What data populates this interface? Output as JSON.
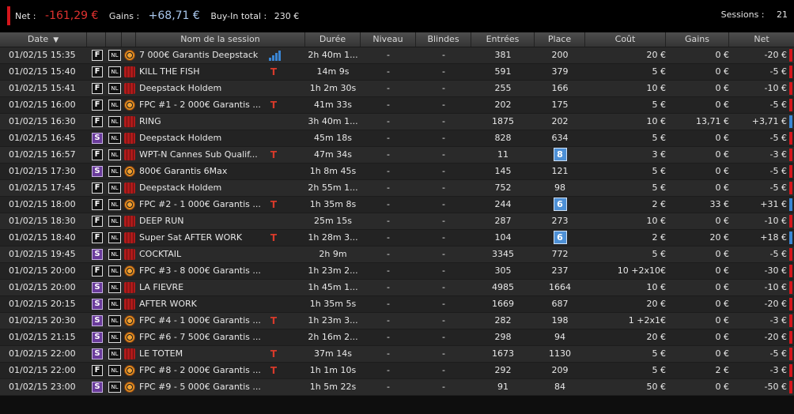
{
  "summary": {
    "net_label": "Net :",
    "net_value": "-161,29 €",
    "gains_label": "Gains :",
    "gains_value": "+68,71 €",
    "buyin_label": "Buy-In total :",
    "buyin_value": "230 €",
    "sessions_label": "Sessions :",
    "sessions_value": "21"
  },
  "colors": {
    "negative": "#d4161c",
    "positive": "#3a86d4",
    "badge": "#4d90d6"
  },
  "columns": {
    "date": "Date",
    "name": "Nom de la session",
    "duration": "Durée",
    "level": "Niveau",
    "blinds": "Blindes",
    "entries": "Entrées",
    "place": "Place",
    "cost": "Coût",
    "gains": "Gains",
    "net": "Net"
  },
  "rows": [
    {
      "date": "01/02/15 15:35",
      "game": "F",
      "nl": "NL",
      "room": "chip-icon",
      "name": "7 000€ Garantis Deepstack",
      "tag": "bars-icon",
      "duration": "2h 40m 1...",
      "level": "-",
      "blinds": "-",
      "entries": "381",
      "place": "200",
      "cost": "20 €",
      "gains": "0 €",
      "net": "-20 €",
      "result": "negative"
    },
    {
      "date": "01/02/15 15:40",
      "game": "F",
      "nl": "NL",
      "room": "deck-icon",
      "name": "KILL THE FISH",
      "tag": "ticket-icon",
      "duration": "14m 9s",
      "level": "-",
      "blinds": "-",
      "entries": "591",
      "place": "379",
      "cost": "5 €",
      "gains": "0 €",
      "net": "-5 €",
      "result": "negative"
    },
    {
      "date": "01/02/15 15:41",
      "game": "F",
      "nl": "NL",
      "room": "deck-icon",
      "name": "Deepstack Holdem",
      "tag": "",
      "duration": "1h 2m 30s",
      "level": "-",
      "blinds": "-",
      "entries": "255",
      "place": "166",
      "cost": "10 €",
      "gains": "0 €",
      "net": "-10 €",
      "result": "negative"
    },
    {
      "date": "01/02/15 16:00",
      "game": "F",
      "nl": "NL",
      "room": "chip-icon",
      "name": "FPC #1 - 2 000€ Garantis ...",
      "tag": "ticket-icon",
      "duration": "41m 33s",
      "level": "-",
      "blinds": "-",
      "entries": "202",
      "place": "175",
      "cost": "5 €",
      "gains": "0 €",
      "net": "-5 €",
      "result": "negative"
    },
    {
      "date": "01/02/15 16:30",
      "game": "F",
      "nl": "NL",
      "room": "deck-icon",
      "name": "RING",
      "tag": "",
      "duration": "3h 40m 1...",
      "level": "-",
      "blinds": "-",
      "entries": "1875",
      "place": "202",
      "cost": "10 €",
      "gains": "13,71 €",
      "net": "+3,71 €",
      "result": "positive"
    },
    {
      "date": "01/02/15 16:45",
      "game": "S",
      "nl": "NL",
      "room": "deck-icon",
      "name": "Deepstack Holdem",
      "tag": "",
      "duration": "45m 18s",
      "level": "-",
      "blinds": "-",
      "entries": "828",
      "place": "634",
      "cost": "5 €",
      "gains": "0 €",
      "net": "-5 €",
      "result": "negative"
    },
    {
      "date": "01/02/15 16:57",
      "game": "F",
      "nl": "NL",
      "room": "deck-icon",
      "name": "WPT-N Cannes Sub Qualif...",
      "tag": "ticket-icon",
      "duration": "47m 34s",
      "level": "-",
      "blinds": "-",
      "entries": "11",
      "place": "8",
      "place_badge": true,
      "cost": "3 €",
      "gains": "0 €",
      "net": "-3 €",
      "result": "negative"
    },
    {
      "date": "01/02/15 17:30",
      "game": "S",
      "nl": "NL",
      "room": "chip-icon",
      "name": "800€ Garantis 6Max",
      "tag": "",
      "duration": "1h 8m 45s",
      "level": "-",
      "blinds": "-",
      "entries": "145",
      "place": "121",
      "cost": "5 €",
      "gains": "0 €",
      "net": "-5 €",
      "result": "negative"
    },
    {
      "date": "01/02/15 17:45",
      "game": "F",
      "nl": "NL",
      "room": "deck-icon",
      "name": "Deepstack Holdem",
      "tag": "",
      "duration": "2h 55m 1...",
      "level": "-",
      "blinds": "-",
      "entries": "752",
      "place": "98",
      "cost": "5 €",
      "gains": "0 €",
      "net": "-5 €",
      "result": "negative"
    },
    {
      "date": "01/02/15 18:00",
      "game": "F",
      "nl": "NL",
      "room": "chip-icon",
      "name": "FPC #2 - 1 000€ Garantis ...",
      "tag": "ticket-icon",
      "duration": "1h 35m 8s",
      "level": "-",
      "blinds": "-",
      "entries": "244",
      "place": "6",
      "place_badge": true,
      "cost": "2 €",
      "gains": "33 €",
      "net": "+31 €",
      "result": "positive"
    },
    {
      "date": "01/02/15 18:30",
      "game": "F",
      "nl": "NL",
      "room": "deck-icon",
      "name": "DEEP RUN",
      "tag": "",
      "duration": "25m 15s",
      "level": "-",
      "blinds": "-",
      "entries": "287",
      "place": "273",
      "cost": "10 €",
      "gains": "0 €",
      "net": "-10 €",
      "result": "negative"
    },
    {
      "date": "01/02/15 18:40",
      "game": "F",
      "nl": "NL",
      "room": "deck-icon",
      "name": "Super Sat AFTER WORK",
      "tag": "ticket-icon",
      "duration": "1h 28m 3...",
      "level": "-",
      "blinds": "-",
      "entries": "104",
      "place": "6",
      "place_badge": true,
      "cost": "2 €",
      "gains": "20 €",
      "net": "+18 €",
      "result": "positive"
    },
    {
      "date": "01/02/15 19:45",
      "game": "S",
      "nl": "NL",
      "room": "deck-icon",
      "name": "COCKTAIL",
      "tag": "",
      "duration": "2h 9m",
      "level": "-",
      "blinds": "-",
      "entries": "3345",
      "place": "772",
      "cost": "5 €",
      "gains": "0 €",
      "net": "-5 €",
      "result": "negative"
    },
    {
      "date": "01/02/15 20:00",
      "game": "F",
      "nl": "NL",
      "room": "chip-icon",
      "name": "FPC #3 - 8 000€ Garantis ...",
      "tag": "",
      "duration": "1h 23m 2...",
      "level": "-",
      "blinds": "-",
      "entries": "305",
      "place": "237",
      "cost": "10  +2x10€",
      "gains": "0 €",
      "net": "-30 €",
      "result": "negative"
    },
    {
      "date": "01/02/15 20:00",
      "game": "S",
      "nl": "NL",
      "room": "deck-icon",
      "name": "LA FIEVRE",
      "tag": "",
      "duration": "1h 45m 1...",
      "level": "-",
      "blinds": "-",
      "entries": "4985",
      "place": "1664",
      "cost": "10 €",
      "gains": "0 €",
      "net": "-10 €",
      "result": "negative"
    },
    {
      "date": "01/02/15 20:15",
      "game": "S",
      "nl": "NL",
      "room": "deck-icon",
      "name": "AFTER WORK",
      "tag": "",
      "duration": "1h 35m 5s",
      "level": "-",
      "blinds": "-",
      "entries": "1669",
      "place": "687",
      "cost": "20 €",
      "gains": "0 €",
      "net": "-20 €",
      "result": "negative"
    },
    {
      "date": "01/02/15 20:30",
      "game": "S",
      "nl": "NL",
      "room": "chip-icon",
      "name": "FPC #4 - 1 000€ Garantis ...",
      "tag": "ticket-icon",
      "duration": "1h 23m 3...",
      "level": "-",
      "blinds": "-",
      "entries": "282",
      "place": "198",
      "cost": "1  +2x1€",
      "gains": "0 €",
      "net": "-3 €",
      "result": "negative"
    },
    {
      "date": "01/02/15 21:15",
      "game": "S",
      "nl": "NL",
      "room": "chip-icon",
      "name": "FPC #6 - 7 500€ Garantis ...",
      "tag": "",
      "duration": "2h 16m 2...",
      "level": "-",
      "blinds": "-",
      "entries": "298",
      "place": "94",
      "cost": "20 €",
      "gains": "0 €",
      "net": "-20 €",
      "result": "negative"
    },
    {
      "date": "01/02/15 22:00",
      "game": "S",
      "nl": "NL",
      "room": "deck-icon",
      "name": "LE TOTEM",
      "tag": "ticket-icon",
      "duration": "37m 14s",
      "level": "-",
      "blinds": "-",
      "entries": "1673",
      "place": "1130",
      "cost": "5 €",
      "gains": "0 €",
      "net": "-5 €",
      "result": "negative"
    },
    {
      "date": "01/02/15 22:00",
      "game": "F",
      "nl": "NL",
      "room": "chip-icon",
      "name": "FPC #8 - 2 000€ Garantis ...",
      "tag": "ticket-icon",
      "duration": "1h 1m 10s",
      "level": "-",
      "blinds": "-",
      "entries": "292",
      "place": "209",
      "cost": "5 €",
      "gains": "2 €",
      "net": "-3 €",
      "result": "negative"
    },
    {
      "date": "01/02/15 23:00",
      "game": "S",
      "nl": "NL",
      "room": "chip-icon",
      "name": "FPC #9 - 5 000€ Garantis ...",
      "tag": "",
      "duration": "1h 5m 22s",
      "level": "-",
      "blinds": "-",
      "entries": "91",
      "place": "84",
      "cost": "50 €",
      "gains": "0 €",
      "net": "-50 €",
      "result": "negative"
    }
  ]
}
